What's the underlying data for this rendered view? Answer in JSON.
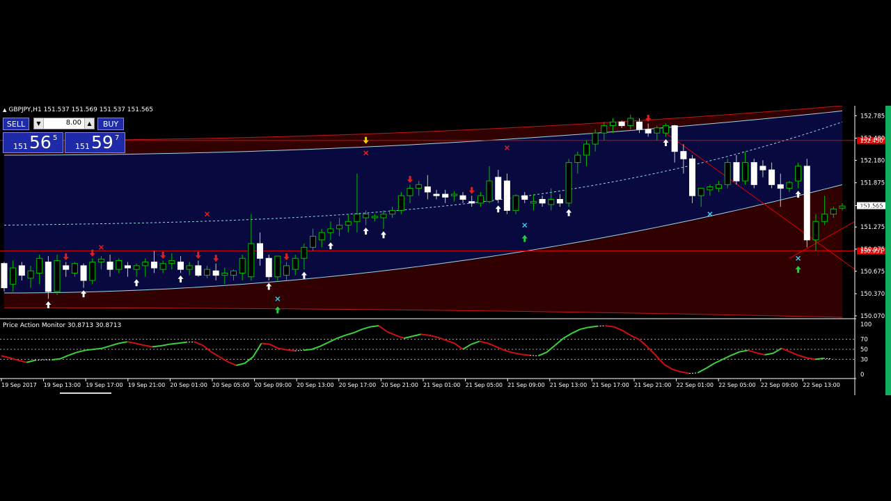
{
  "header": {
    "symbol_line": "GBPJPY,H1  151.537 151.569 151.537 151.565"
  },
  "trade_panel": {
    "sell_label": "SELL",
    "buy_label": "BUY",
    "lot_value": "8.00",
    "sell_price": {
      "prefix": "151",
      "big": "56",
      "sup": "5"
    },
    "buy_price": {
      "prefix": "151",
      "big": "59",
      "sup": "7"
    }
  },
  "colors": {
    "bull_candle": "#00c000",
    "bear_candle": "#ffffff",
    "channel_blue": "#000a4a",
    "channel_red": "#3a0000",
    "band_line": "#9fd8e8",
    "level_line": "#e00000",
    "osc_up": "#3cd23c",
    "osc_down": "#d01010",
    "osc_neutral": "#ffffff"
  },
  "chart_data": [
    {
      "type": "candlestick",
      "symbol": "GBPJPY",
      "timeframe": "H1",
      "ylim": [
        150.05,
        152.92
      ],
      "y_ticks": [
        "152.785",
        "152.480",
        "152.180",
        "151.875",
        "151.565",
        "151.275",
        "150.975",
        "150.675",
        "150.370",
        "150.070"
      ],
      "x_ticks": [
        "19 Sep 2017",
        "19 Sep 13:00",
        "19 Sep 17:00",
        "19 Sep 21:00",
        "20 Sep 01:00",
        "20 Sep 05:00",
        "20 Sep 09:00",
        "20 Sep 13:00",
        "20 Sep 17:00",
        "20 Sep 21:00",
        "21 Sep 01:00",
        "21 Sep 05:00",
        "21 Sep 09:00",
        "21 Sep 13:00",
        "21 Sep 17:00",
        "21 Sep 21:00",
        "22 Sep 01:00",
        "22 Sep 05:00",
        "22 Sep 09:00",
        "22 Sep 13:00"
      ],
      "levels": [
        {
          "price": 152.45,
          "label": "152.450"
        },
        {
          "price": 150.951,
          "label": "150.951"
        }
      ],
      "current_price": {
        "price": 151.565,
        "label": "151.565"
      },
      "candles": [
        [
          150.78,
          150.8,
          150.4,
          150.45
        ],
        [
          150.5,
          150.82,
          150.4,
          150.72
        ],
        [
          150.75,
          150.8,
          150.55,
          150.62
        ],
        [
          150.58,
          150.75,
          150.45,
          150.68
        ],
        [
          150.65,
          150.9,
          150.5,
          150.85
        ],
        [
          150.8,
          150.88,
          150.3,
          150.4
        ],
        [
          150.4,
          150.9,
          150.35,
          150.82
        ],
        [
          150.75,
          150.8,
          150.6,
          150.7
        ],
        [
          150.65,
          150.8,
          150.6,
          150.78
        ],
        [
          150.75,
          150.78,
          150.45,
          150.55
        ],
        [
          150.55,
          150.85,
          150.5,
          150.8
        ],
        [
          150.8,
          150.88,
          150.7,
          150.84
        ],
        [
          150.8,
          150.9,
          150.6,
          150.7
        ],
        [
          150.7,
          150.85,
          150.65,
          150.82
        ],
        [
          150.75,
          150.8,
          150.6,
          150.72
        ],
        [
          150.7,
          150.78,
          150.6,
          150.75
        ],
        [
          150.75,
          150.85,
          150.6,
          150.8
        ],
        [
          150.8,
          150.95,
          150.65,
          150.72
        ],
        [
          150.7,
          150.82,
          150.65,
          150.78
        ],
        [
          150.78,
          150.92,
          150.7,
          150.82
        ],
        [
          150.8,
          150.88,
          150.65,
          150.7
        ],
        [
          150.7,
          150.8,
          150.62,
          150.75
        ],
        [
          150.75,
          150.82,
          150.6,
          150.62
        ],
        [
          150.62,
          150.75,
          150.58,
          150.7
        ],
        [
          150.68,
          150.78,
          150.55,
          150.62
        ],
        [
          150.62,
          150.72,
          150.5,
          150.65
        ],
        [
          150.62,
          150.7,
          150.55,
          150.68
        ],
        [
          150.65,
          150.9,
          150.55,
          150.85
        ],
        [
          150.6,
          151.45,
          150.55,
          151.05
        ],
        [
          151.05,
          151.2,
          150.75,
          150.85
        ],
        [
          150.85,
          150.9,
          150.55,
          150.6
        ],
        [
          150.6,
          150.85,
          150.55,
          150.88
        ],
        [
          150.62,
          150.8,
          150.55,
          150.75
        ],
        [
          150.7,
          150.9,
          150.62,
          150.85
        ],
        [
          150.85,
          151.05,
          150.7,
          151.0
        ],
        [
          151.0,
          151.25,
          150.95,
          151.15
        ],
        [
          151.1,
          151.25,
          151.0,
          151.2
        ],
        [
          151.2,
          151.35,
          151.1,
          151.25
        ],
        [
          151.25,
          151.4,
          151.15,
          151.3
        ],
        [
          151.3,
          151.45,
          151.2,
          151.35
        ],
        [
          151.35,
          152.0,
          151.2,
          151.45
        ],
        [
          151.4,
          151.5,
          151.3,
          151.45
        ],
        [
          151.4,
          151.45,
          151.35,
          151.42
        ],
        [
          151.4,
          151.5,
          151.25,
          151.45
        ],
        [
          151.45,
          151.55,
          151.4,
          151.5
        ],
        [
          151.5,
          151.75,
          151.45,
          151.7
        ],
        [
          151.7,
          151.85,
          151.6,
          151.8
        ],
        [
          151.8,
          151.9,
          151.7,
          151.85
        ],
        [
          151.82,
          151.98,
          151.65,
          151.75
        ],
        [
          151.72,
          151.78,
          151.65,
          151.7
        ],
        [
          151.72,
          151.78,
          151.6,
          151.68
        ],
        [
          151.7,
          151.76,
          151.62,
          151.72
        ],
        [
          151.7,
          151.75,
          151.6,
          151.65
        ],
        [
          151.62,
          151.7,
          151.55,
          151.6
        ],
        [
          151.6,
          151.75,
          151.55,
          151.7
        ],
        [
          151.62,
          152.1,
          151.6,
          151.9
        ],
        [
          151.95,
          152.05,
          151.6,
          151.65
        ],
        [
          151.9,
          152.0,
          151.45,
          151.5
        ],
        [
          151.5,
          151.72,
          151.45,
          151.7
        ],
        [
          151.7,
          151.75,
          151.6,
          151.65
        ],
        [
          151.6,
          151.72,
          151.5,
          151.62
        ],
        [
          151.65,
          151.7,
          151.55,
          151.6
        ],
        [
          151.58,
          151.8,
          151.5,
          151.65
        ],
        [
          151.65,
          151.72,
          151.55,
          151.6
        ],
        [
          151.6,
          152.2,
          151.55,
          152.15
        ],
        [
          152.15,
          152.3,
          152.0,
          152.25
        ],
        [
          152.25,
          152.45,
          152.1,
          152.4
        ],
        [
          152.4,
          152.6,
          152.3,
          152.55
        ],
        [
          152.55,
          152.7,
          152.45,
          152.65
        ],
        [
          152.65,
          152.75,
          152.55,
          152.7
        ],
        [
          152.7,
          152.72,
          152.62,
          152.65
        ],
        [
          152.65,
          152.8,
          152.6,
          152.75
        ],
        [
          152.7,
          152.75,
          152.55,
          152.6
        ],
        [
          152.6,
          152.68,
          152.5,
          152.55
        ],
        [
          152.55,
          152.65,
          152.45,
          152.62
        ],
        [
          152.55,
          152.68,
          152.5,
          152.65
        ],
        [
          152.65,
          152.66,
          152.15,
          152.3
        ],
        [
          152.3,
          152.4,
          152.0,
          152.2
        ],
        [
          152.2,
          152.25,
          151.6,
          151.7
        ],
        [
          151.7,
          151.8,
          151.55,
          151.8
        ],
        [
          151.78,
          151.85,
          151.7,
          151.82
        ],
        [
          151.8,
          151.9,
          151.75,
          151.85
        ],
        [
          151.85,
          152.2,
          151.8,
          152.15
        ],
        [
          152.15,
          152.25,
          151.85,
          151.9
        ],
        [
          151.9,
          152.3,
          151.85,
          152.15
        ],
        [
          152.15,
          152.2,
          151.8,
          151.85
        ],
        [
          152.1,
          152.18,
          151.95,
          152.05
        ],
        [
          152.05,
          152.15,
          151.8,
          151.85
        ],
        [
          151.85,
          152.0,
          151.55,
          151.8
        ],
        [
          151.8,
          151.9,
          151.75,
          151.88
        ],
        [
          151.9,
          152.15,
          151.8,
          152.1
        ],
        [
          152.1,
          152.2,
          151.0,
          151.1
        ],
        [
          151.1,
          151.45,
          150.95,
          151.35
        ],
        [
          151.35,
          151.7,
          151.3,
          151.45
        ],
        [
          151.45,
          151.55,
          151.4,
          151.52
        ],
        [
          151.53,
          151.6,
          151.5,
          151.56
        ]
      ]
    },
    {
      "type": "line",
      "title": "Price Action Monitor 30.8713 30.8713",
      "ylim": [
        0,
        100
      ],
      "y_ticks": [
        "100",
        "70",
        "50",
        "30",
        "0"
      ],
      "guides": [
        70,
        50,
        30
      ],
      "values": [
        37,
        33,
        28,
        24,
        28,
        29,
        29,
        31,
        38,
        44,
        48,
        50,
        52,
        57,
        62,
        65,
        62,
        58,
        55,
        57,
        60,
        62,
        64,
        65,
        58,
        45,
        35,
        25,
        18,
        22,
        35,
        62,
        60,
        52,
        49,
        47,
        48,
        50,
        56,
        64,
        72,
        78,
        83,
        90,
        95,
        97,
        85,
        78,
        72,
        76,
        80,
        78,
        74,
        68,
        62,
        50,
        60,
        66,
        62,
        55,
        48,
        43,
        40,
        38,
        37,
        44,
        58,
        72,
        82,
        90,
        94,
        96,
        97,
        95,
        88,
        78,
        70,
        55,
        38,
        20,
        10,
        5,
        2,
        3,
        12,
        22,
        30,
        38,
        45,
        48,
        43,
        39,
        42,
        52,
        45,
        38,
        33,
        30,
        32,
        31
      ]
    }
  ]
}
